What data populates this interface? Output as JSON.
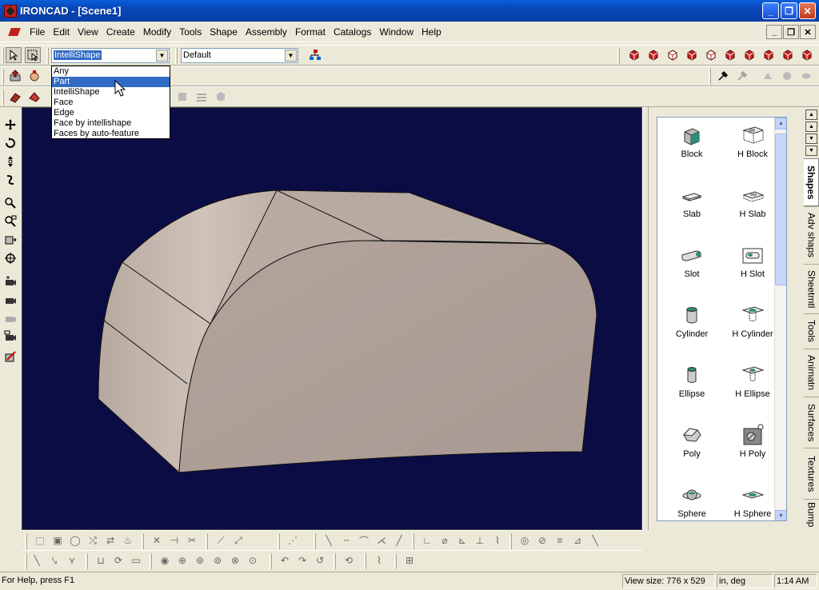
{
  "window": {
    "title": "IRONCAD - [Scene1]"
  },
  "menubar": {
    "items": [
      {
        "label": "File"
      },
      {
        "label": "Edit"
      },
      {
        "label": "View"
      },
      {
        "label": "Create"
      },
      {
        "label": "Modify"
      },
      {
        "label": "Tools"
      },
      {
        "label": "Shape"
      },
      {
        "label": "Assembly"
      },
      {
        "label": "Format"
      },
      {
        "label": "Catalogs"
      },
      {
        "label": "Window"
      },
      {
        "label": "Help"
      }
    ]
  },
  "toolbar": {
    "selection_filter": {
      "value": "IntelliShape",
      "options": [
        "Any",
        "Part",
        "IntelliShape",
        "Face",
        "Edge",
        "Face by intellishape",
        "Faces by auto-feature"
      ],
      "highlighted": "Part"
    },
    "style_combo": {
      "value": "Default"
    }
  },
  "catalog": {
    "items": [
      {
        "label": "Block",
        "icon": "block-icon"
      },
      {
        "label": "H Block",
        "icon": "hollow-block-icon"
      },
      {
        "label": "Slab",
        "icon": "slab-icon"
      },
      {
        "label": "H Slab",
        "icon": "hollow-slab-icon"
      },
      {
        "label": "Slot",
        "icon": "slot-icon"
      },
      {
        "label": "H Slot",
        "icon": "hollow-slot-icon"
      },
      {
        "label": "Cylinder",
        "icon": "cylinder-icon"
      },
      {
        "label": "H Cylinder",
        "icon": "hollow-cylinder-icon"
      },
      {
        "label": "Ellipse",
        "icon": "ellipse-icon"
      },
      {
        "label": "H Ellipse",
        "icon": "hollow-ellipse-icon"
      },
      {
        "label": "Poly",
        "icon": "poly-icon"
      },
      {
        "label": "H Poly",
        "icon": "hollow-poly-icon"
      },
      {
        "label": "Sphere",
        "icon": "sphere-icon"
      },
      {
        "label": "H Sphere",
        "icon": "hollow-sphere-icon"
      }
    ],
    "tabs": [
      {
        "label": "Shapes",
        "active": true
      },
      {
        "label": "Adv shaps"
      },
      {
        "label": "Sheetmtl"
      },
      {
        "label": "Tools"
      },
      {
        "label": "Animatn"
      },
      {
        "label": "Surfaces"
      },
      {
        "label": "Textures"
      },
      {
        "label": "Bump"
      }
    ]
  },
  "statusbar": {
    "help": "For Help, press F1",
    "view_size": "View size:  776 x  529",
    "units": "in, deg",
    "time": "1:14 AM"
  },
  "colors": {
    "viewport_bg": "#0c0c44",
    "part_face": "#b9aba2",
    "titlebar": "#0846b8",
    "selection": "#316ac5"
  }
}
